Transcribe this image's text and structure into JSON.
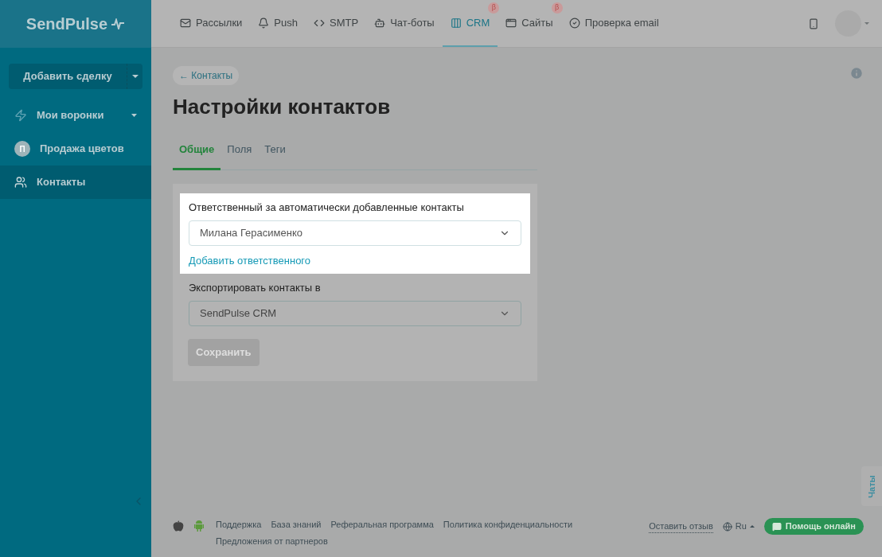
{
  "logo": "SendPulse",
  "nav": [
    {
      "label": "Рассылки",
      "kind": "mail",
      "selected": false
    },
    {
      "label": "Push",
      "kind": "bell",
      "selected": false
    },
    {
      "label": "SMTP",
      "kind": "code",
      "selected": false
    },
    {
      "label": "Чат-боты",
      "kind": "bot",
      "selected": false
    },
    {
      "label": "CRM",
      "kind": "crm",
      "selected": true,
      "badge": "β"
    },
    {
      "label": "Сайты",
      "kind": "site",
      "selected": false,
      "badge": "β"
    },
    {
      "label": "Проверка email",
      "kind": "check",
      "selected": false
    }
  ],
  "sidebar": {
    "add_button": "Добавить сделку",
    "items": [
      {
        "kind": "funnel",
        "label": "Мои воронки",
        "selected": false
      },
      {
        "kind": "avatar",
        "letter": "П",
        "label": "Продажа цветов",
        "selected": false
      },
      {
        "kind": "contacts",
        "label": "Контакты",
        "selected": true
      }
    ]
  },
  "breadcrumb": "← Контакты",
  "title": "Настройки контактов",
  "tabs": [
    {
      "label": "Общие",
      "selected": true
    },
    {
      "label": "Поля",
      "selected": false
    },
    {
      "label": "Теги",
      "selected": false
    }
  ],
  "fields": [
    {
      "label": "Ответственный за автоматически добавленные контакты",
      "value": "Милана Герасименко",
      "link": "Добавить ответственного",
      "highlighted": true
    },
    {
      "label": "Экспортировать контакты в",
      "value": "SendPulse CRM",
      "highlighted": false
    }
  ],
  "save_button": {
    "label": "Сохранить",
    "disabled": true
  },
  "chat_tab": "Чаты",
  "footer": {
    "links": [
      "Поддержка",
      "База знаний",
      "Реферальная программа",
      "Политика конфиденциальности",
      "Предложения от партнеров"
    ],
    "feedback": "Оставить отзыв",
    "language": "Ru",
    "help_button": "Помощь онлайн"
  }
}
